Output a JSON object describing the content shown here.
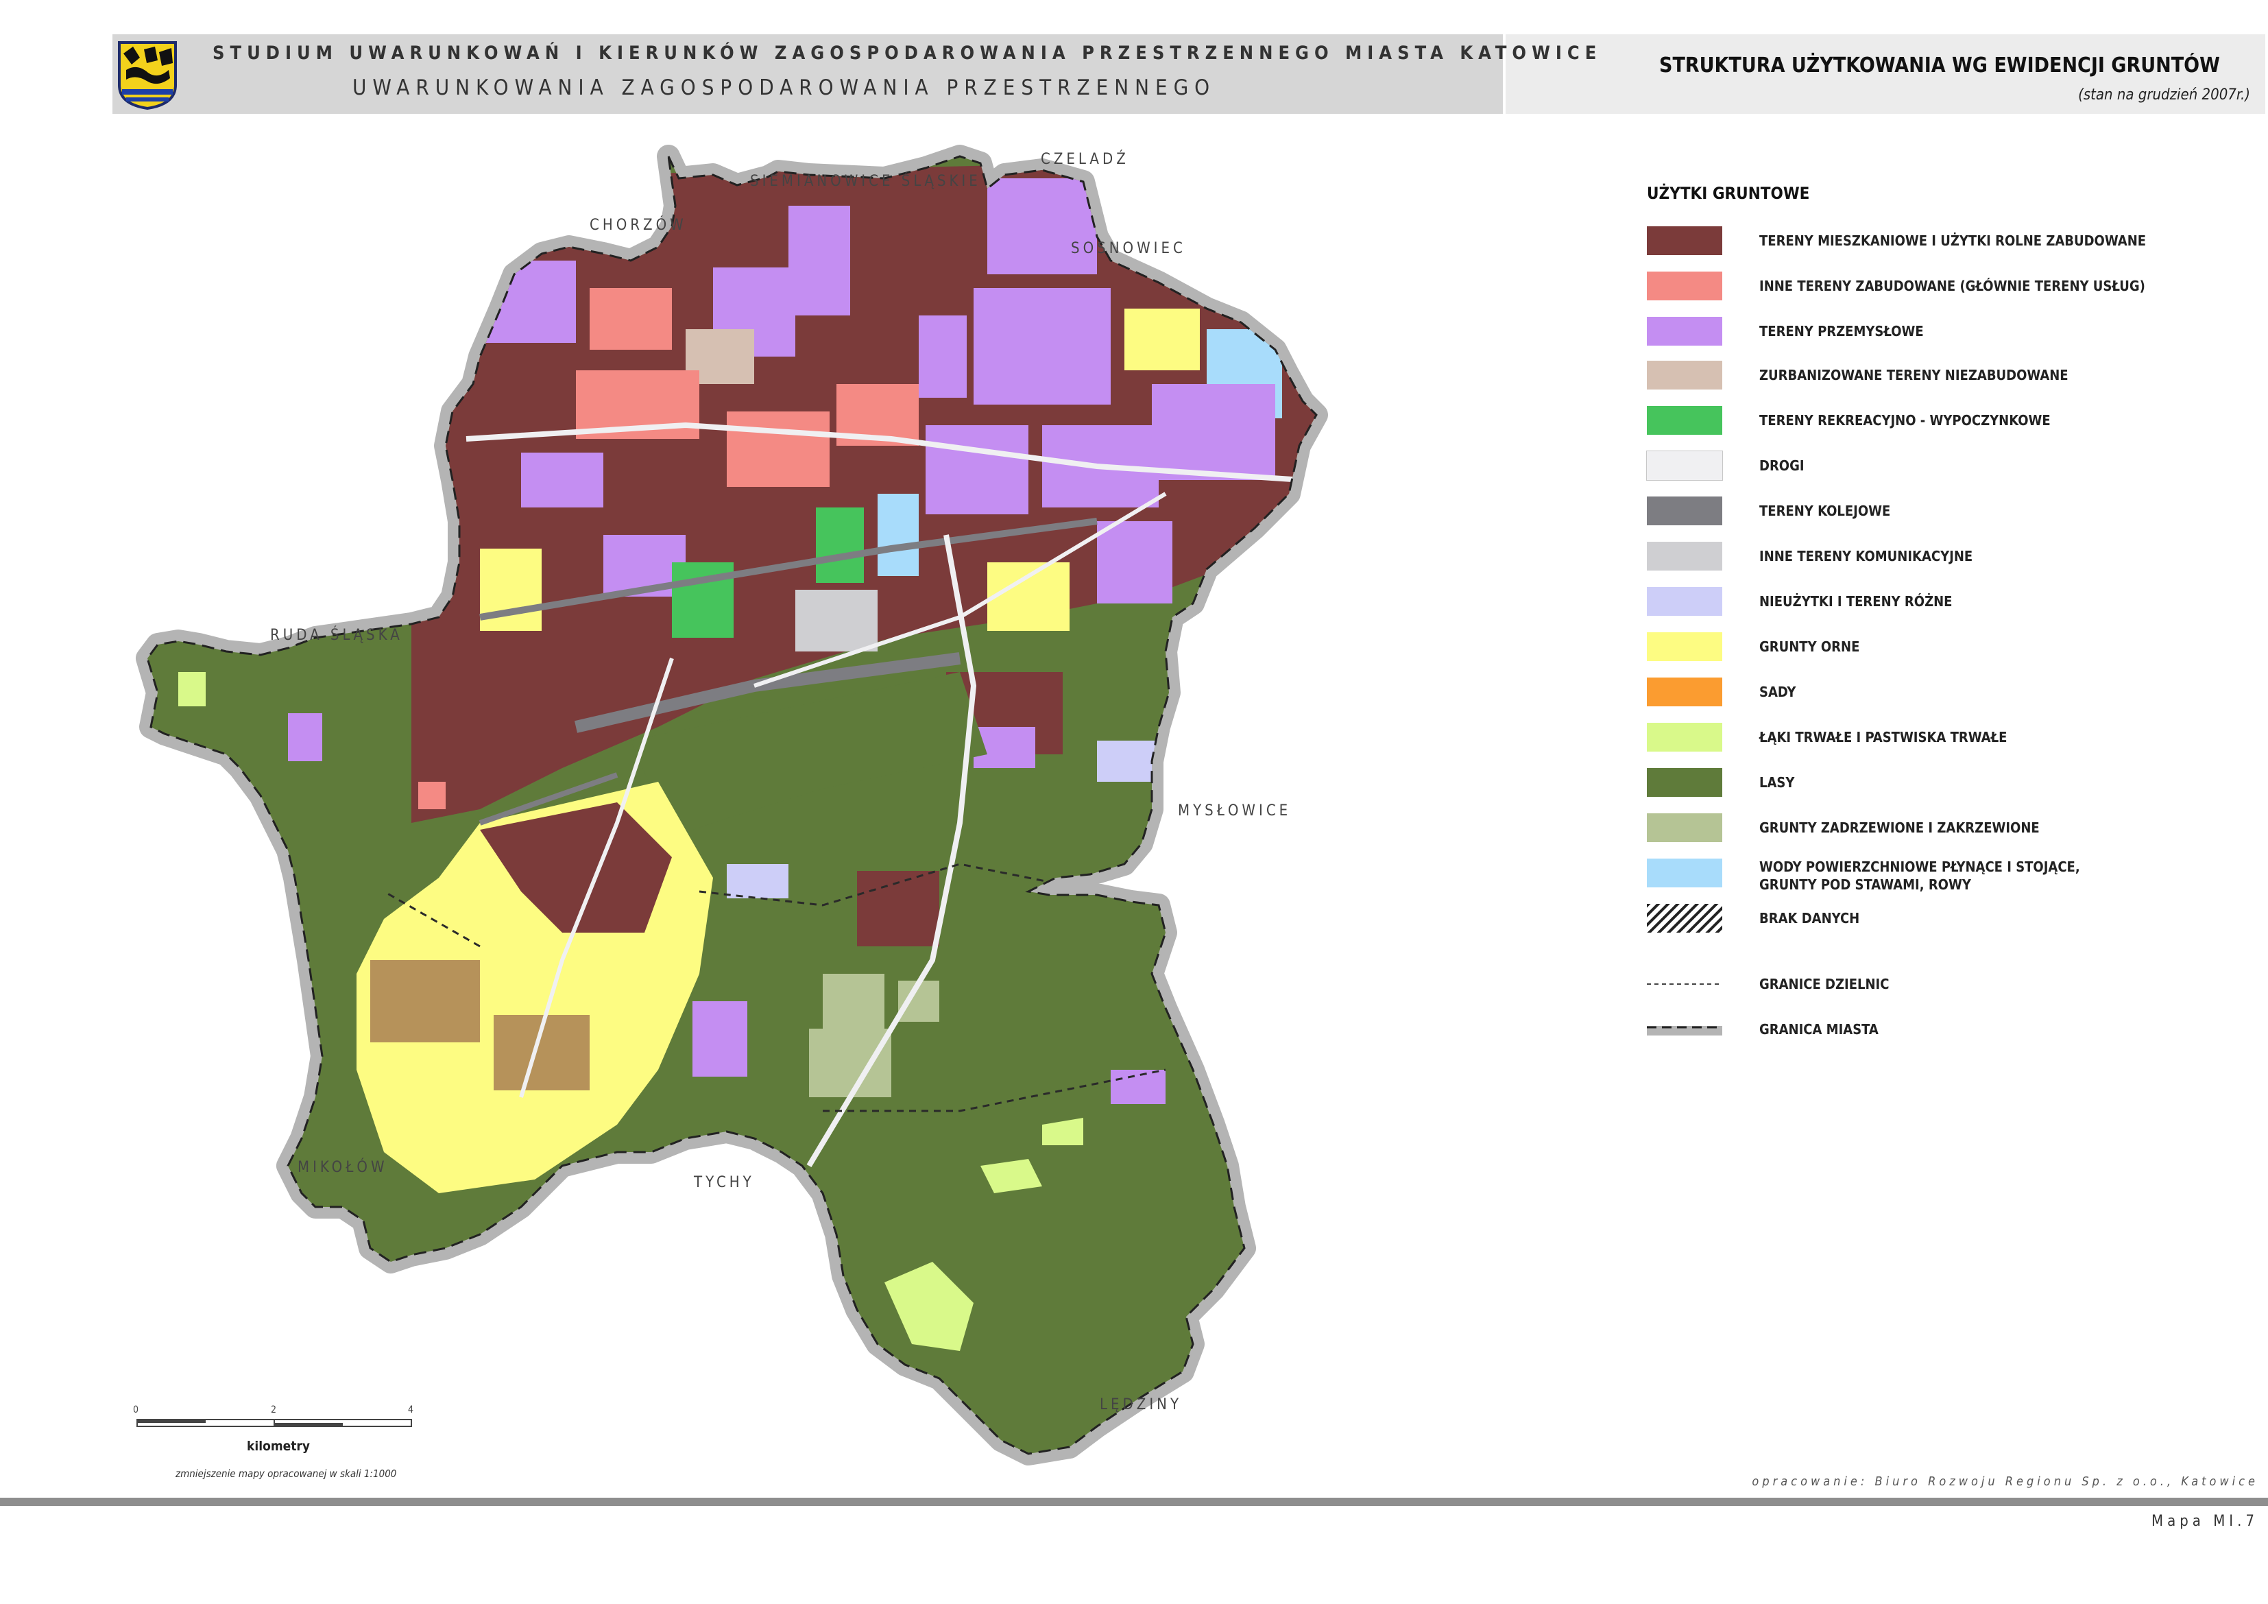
{
  "header": {
    "line1": "STUDIUM UWARUNKOWAŃ I KIERUNKÓW ZAGOSPODAROWANIA PRZESTRZENNEGO MIASTA KATOWICE",
    "line2": "UWARUNKOWANIA ZAGOSPODAROWANIA PRZESTRZENNEGO",
    "title": "STRUKTURA UŻYTKOWANIA WG EWIDENCJI GRUNTÓW",
    "subtitle": "(stan na grudzień 2007r.)"
  },
  "colors": {
    "residential": "#7b3b3a",
    "other_built": "#f48a84",
    "industrial": "#c48ef2",
    "urbanized_unbuilt": "#d6c0b2",
    "recreation": "#46c45c",
    "roads": "#f0f0f2",
    "railway": "#7d7d82",
    "other_transport": "#cfcfd2",
    "wasteland": "#cdcef8",
    "arable": "#fdfc82",
    "orchards": "#fb9c30",
    "meadows": "#d9f98a",
    "forest": "#5f7b3a",
    "wooded": "#b5c495",
    "water": "#a8dcfb",
    "boundary_halo": "#b4b4b4"
  },
  "cities": {
    "chorzow": "CHORZÓW",
    "siemianowice": "SIEMIANOWICE ŚLĄSKIE",
    "czeladz": "CZELADŹ",
    "sosnowiec": "SOSNOWIEC",
    "ruda": "RUDA ŚLĄSKA",
    "myslowice": "MYSŁOWICE",
    "mikolow": "MIKOŁÓW",
    "tychy": "TYCHY",
    "ledziny": "LĘDZINY"
  },
  "legend": {
    "heading": "UŻYTKI GRUNTOWE",
    "items": [
      {
        "label": "TERENY MIESZKANIOWE I UŻYTKI ROLNE ZABUDOWANE",
        "color": "#7b3b3a"
      },
      {
        "label": "INNE TERENY ZABUDOWANE (GŁÓWNIE TERENY USŁUG)",
        "color": "#f48a84"
      },
      {
        "label": "TERENY PRZEMYSŁOWE",
        "color": "#c48ef2"
      },
      {
        "label": "ZURBANIZOWANE TERENY NIEZABUDOWANE",
        "color": "#d6c0b2"
      },
      {
        "label": "TERENY REKREACYJNO - WYPOCZYNKOWE",
        "color": "#46c45c"
      },
      {
        "label": "DROGI",
        "color": "#f0f0f2"
      },
      {
        "label": "TERENY KOLEJOWE",
        "color": "#7d7d82"
      },
      {
        "label": "INNE TERENY KOMUNIKACYJNE",
        "color": "#cfcfd2"
      },
      {
        "label": "NIEUŻYTKI I TERENY RÓŻNE",
        "color": "#cdcef8"
      },
      {
        "label": "GRUNTY ORNE",
        "color": "#fdfc82"
      },
      {
        "label": "SADY",
        "color": "#fb9c30"
      },
      {
        "label": "ŁĄKI TRWAŁE I PASTWISKA TRWAŁE",
        "color": "#d9f98a"
      },
      {
        "label": "LASY",
        "color": "#5f7b3a"
      },
      {
        "label": "GRUNTY ZADRZEWIONE I ZAKRZEWIONE",
        "color": "#b5c495"
      },
      {
        "label": "WODY POWIERZCHNIOWE PŁYNĄCE I STOJĄCE,",
        "label2": "GRUNTY POD STAWAMI, ROWY",
        "color": "#a8dcfb"
      },
      {
        "label": "BRAK DANYCH",
        "color": "hatch"
      },
      {
        "label": "GRANICE DZIELNIC",
        "color": "dashed"
      },
      {
        "label": "GRANICA MIASTA",
        "color": "boundary"
      }
    ]
  },
  "scale": {
    "ticks": [
      "0",
      "2",
      "4"
    ],
    "unit": "kilometry",
    "note": "zmniejszenie mapy opracowanej w skali 1:1000"
  },
  "footer": {
    "credits": "opracowanie: Biuro Rozwoju Regionu Sp. z o.o., Katowice",
    "map_number": "Mapa MI.7"
  }
}
